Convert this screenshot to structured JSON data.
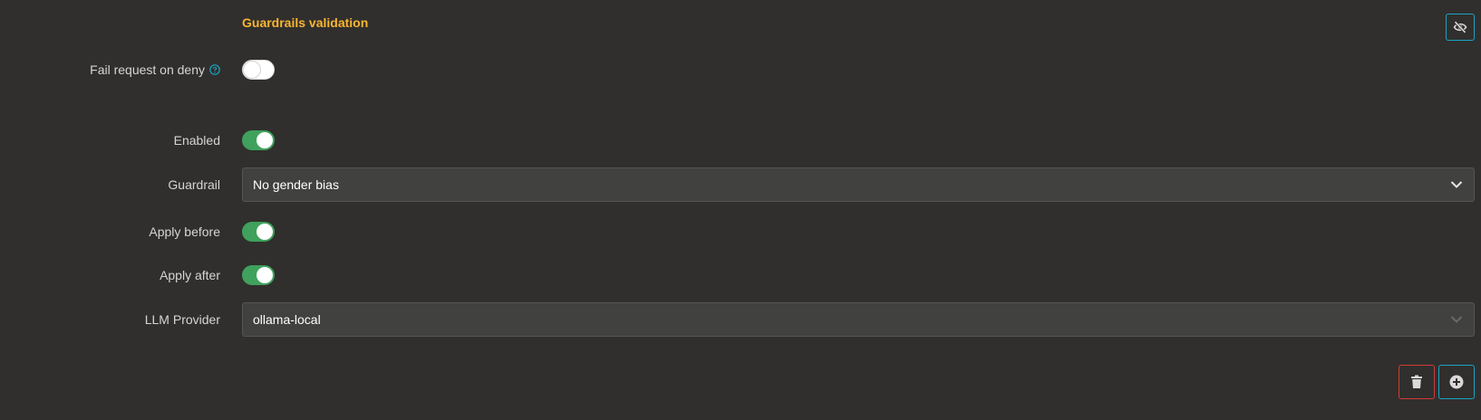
{
  "section": {
    "title": "Guardrails validation"
  },
  "fields": {
    "fail_request_on_deny": {
      "label": "Fail request on deny",
      "value": false
    },
    "enabled": {
      "label": "Enabled",
      "value": true
    },
    "guardrail": {
      "label": "Guardrail",
      "value": "No gender bias"
    },
    "apply_before": {
      "label": "Apply before",
      "value": true
    },
    "apply_after": {
      "label": "Apply after",
      "value": true
    },
    "llm_provider": {
      "label": "LLM Provider",
      "value": "ollama-local"
    }
  },
  "icons": {
    "visibility": "eye-slash-icon",
    "help": "question-circle-icon",
    "delete": "trash-icon",
    "add": "plus-circle-icon",
    "dropdown": "chevron-down-icon"
  },
  "colors": {
    "accent_title": "#f9b531",
    "switch_on": "#3fa15c",
    "info_border": "#1aa4c2",
    "danger_border": "#d23b35",
    "background": "#302f2d",
    "input_background": "#414140"
  }
}
